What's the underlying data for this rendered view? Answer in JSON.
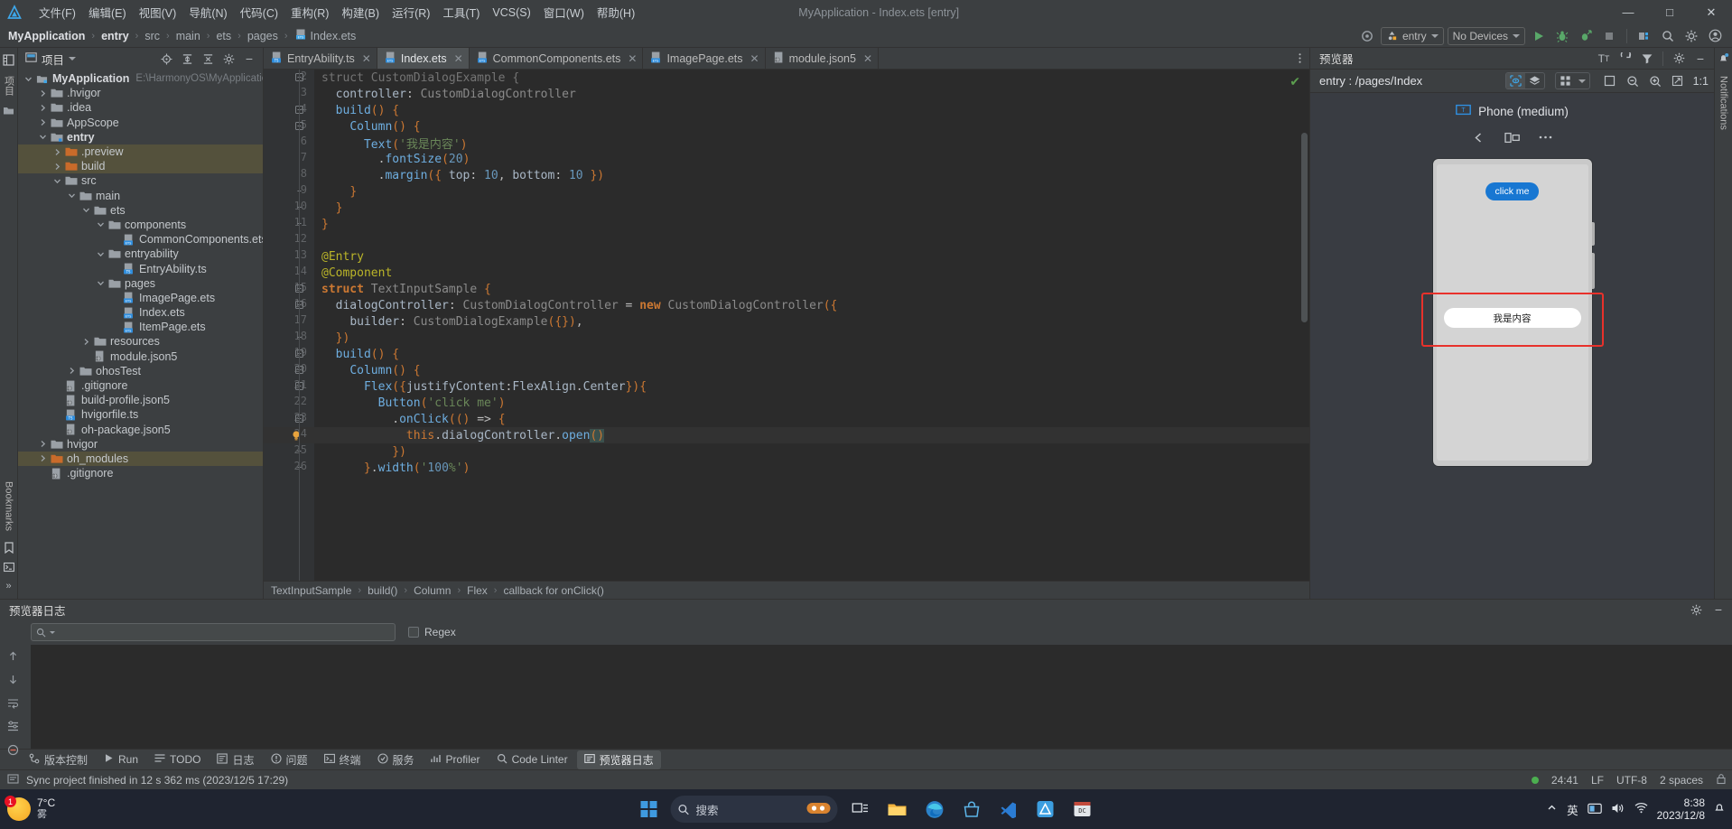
{
  "window": {
    "title": "MyApplication - Index.ets [entry]",
    "minimize": "—",
    "maximize": "□",
    "close": "✕"
  },
  "menu": [
    {
      "label": "文件(F)"
    },
    {
      "label": "编辑(E)"
    },
    {
      "label": "视图(V)"
    },
    {
      "label": "导航(N)"
    },
    {
      "label": "代码(C)"
    },
    {
      "label": "重构(R)"
    },
    {
      "label": "构建(B)"
    },
    {
      "label": "运行(R)"
    },
    {
      "label": "工具(T)"
    },
    {
      "label": "VCS(S)"
    },
    {
      "label": "窗口(W)"
    },
    {
      "label": "帮助(H)"
    }
  ],
  "breadcrumb": {
    "items": [
      "MyApplication",
      "entry",
      "src",
      "main",
      "ets",
      "pages"
    ],
    "file": "Index.ets",
    "separator": "›"
  },
  "toolbar": {
    "run_config": "entry",
    "device": "No Devices",
    "icons": [
      "target-icon",
      "run-icon",
      "debug-icon",
      "profile-run-icon",
      "stop-icon",
      "device-manager-icon",
      "search-everywhere-icon",
      "settings-icon",
      "account-icon"
    ]
  },
  "project": {
    "title": "项目",
    "root": "MyApplication",
    "root_path": "E:\\HarmonyOS\\MyApplicatio",
    "items": [
      {
        "label": ".hvigor",
        "indent": 1,
        "type": "folder",
        "arrow": "right",
        "hl": false
      },
      {
        "label": ".idea",
        "indent": 1,
        "type": "folder",
        "arrow": "right",
        "hl": false
      },
      {
        "label": "AppScope",
        "indent": 1,
        "type": "folder",
        "arrow": "right",
        "hl": false
      },
      {
        "label": "entry",
        "indent": 1,
        "type": "module",
        "arrow": "down",
        "hl": false,
        "bold": true
      },
      {
        "label": ".preview",
        "indent": 2,
        "type": "folder-orange",
        "arrow": "right",
        "hl": true
      },
      {
        "label": "build",
        "indent": 2,
        "type": "folder-orange",
        "arrow": "right",
        "hl": true
      },
      {
        "label": "src",
        "indent": 2,
        "type": "folder",
        "arrow": "down",
        "hl": false
      },
      {
        "label": "main",
        "indent": 3,
        "type": "folder",
        "arrow": "down",
        "hl": false
      },
      {
        "label": "ets",
        "indent": 4,
        "type": "folder",
        "arrow": "down",
        "hl": false
      },
      {
        "label": "components",
        "indent": 5,
        "type": "folder",
        "arrow": "down",
        "hl": false
      },
      {
        "label": "CommonComponents.ets",
        "indent": 6,
        "type": "ets",
        "arrow": "none",
        "hl": false
      },
      {
        "label": "entryability",
        "indent": 5,
        "type": "folder",
        "arrow": "down",
        "hl": false
      },
      {
        "label": "EntryAbility.ts",
        "indent": 6,
        "type": "ts",
        "arrow": "none",
        "hl": false
      },
      {
        "label": "pages",
        "indent": 5,
        "type": "folder",
        "arrow": "down",
        "hl": false
      },
      {
        "label": "ImagePage.ets",
        "indent": 6,
        "type": "ets",
        "arrow": "none",
        "hl": false
      },
      {
        "label": "Index.ets",
        "indent": 6,
        "type": "ets",
        "arrow": "none",
        "hl": false
      },
      {
        "label": "ItemPage.ets",
        "indent": 6,
        "type": "ets",
        "arrow": "none",
        "hl": false
      },
      {
        "label": "resources",
        "indent": 4,
        "type": "folder",
        "arrow": "right",
        "hl": false
      },
      {
        "label": "module.json5",
        "indent": 4,
        "type": "json",
        "arrow": "none",
        "hl": false
      },
      {
        "label": "ohosTest",
        "indent": 3,
        "type": "folder",
        "arrow": "right",
        "hl": false
      },
      {
        "label": ".gitignore",
        "indent": 2,
        "type": "json",
        "arrow": "none",
        "hl": false
      },
      {
        "label": "build-profile.json5",
        "indent": 2,
        "type": "json",
        "arrow": "none",
        "hl": false
      },
      {
        "label": "hvigorfile.ts",
        "indent": 2,
        "type": "ts",
        "arrow": "none",
        "hl": false
      },
      {
        "label": "oh-package.json5",
        "indent": 2,
        "type": "json",
        "arrow": "none",
        "hl": false
      },
      {
        "label": "hvigor",
        "indent": 1,
        "type": "folder",
        "arrow": "right",
        "hl": false
      },
      {
        "label": "oh_modules",
        "indent": 1,
        "type": "folder-orange",
        "arrow": "right",
        "hl": true
      },
      {
        "label": ".gitignore",
        "indent": 1,
        "type": "json",
        "arrow": "none",
        "hl": false
      }
    ]
  },
  "editor": {
    "tabs": [
      {
        "label": "EntryAbility.ts",
        "type": "ts",
        "active": false
      },
      {
        "label": "Index.ets",
        "type": "ets",
        "active": true
      },
      {
        "label": "CommonComponents.ets",
        "type": "ets",
        "active": false
      },
      {
        "label": "ImagePage.ets",
        "type": "ets",
        "active": false
      },
      {
        "label": "module.json5",
        "type": "json",
        "active": false
      }
    ],
    "first_line_number": 2,
    "lines": [
      {
        "n": 2,
        "fold": "open",
        "partial": true
      },
      {
        "n": 3,
        "fold": "none"
      },
      {
        "n": 4,
        "fold": "open"
      },
      {
        "n": 5,
        "fold": "open"
      },
      {
        "n": 6,
        "fold": "none"
      },
      {
        "n": 7,
        "fold": "none"
      },
      {
        "n": 8,
        "fold": "none"
      },
      {
        "n": 9,
        "fold": "close"
      },
      {
        "n": 10,
        "fold": "close"
      },
      {
        "n": 11,
        "fold": "close"
      },
      {
        "n": 12,
        "fold": "none"
      },
      {
        "n": 13,
        "fold": "none"
      },
      {
        "n": 14,
        "fold": "none"
      },
      {
        "n": 15,
        "fold": "open"
      },
      {
        "n": 16,
        "fold": "open"
      },
      {
        "n": 17,
        "fold": "none"
      },
      {
        "n": 18,
        "fold": "close"
      },
      {
        "n": 19,
        "fold": "open"
      },
      {
        "n": 20,
        "fold": "open"
      },
      {
        "n": 21,
        "fold": "open"
      },
      {
        "n": 22,
        "fold": "none"
      },
      {
        "n": 23,
        "fold": "open"
      },
      {
        "n": 24,
        "fold": "none",
        "bulb": true,
        "current": true
      },
      {
        "n": 25,
        "fold": "close"
      },
      {
        "n": 26,
        "fold": "close",
        "partial": true
      }
    ],
    "source_text": [
      "struct CustomDialogExample {",
      "  controller: CustomDialogController",
      "  build() {",
      "    Column() {",
      "      Text('我是内容')",
      "        .fontSize(20)",
      "        .margin({ top: 10, bottom: 10 })",
      "    }",
      "  }",
      "}",
      "",
      "@Entry",
      "@Component",
      "struct TextInputSample {",
      "  dialogController: CustomDialogController = new CustomDialogController({",
      "    builder: CustomDialogExample({}),",
      "  })",
      "  build() {",
      "    Column() {",
      "      Flex({justifyContent:FlexAlign.Center}){",
      "        Button('click me')",
      "          .onClick(() => {",
      "            this.dialogController.open()",
      "          })",
      "      }.width('100%')"
    ],
    "status_ok": "✔",
    "crumbs": [
      "TextInputSample",
      "build()",
      "Column",
      "Flex",
      "callback for onClick()"
    ],
    "crumb_sep": "›"
  },
  "previewer": {
    "title": "预览器",
    "route": "entry : /pages/Index",
    "zoom_label": "1:1",
    "device_name": "Phone (medium)",
    "device_buttons": [
      "rotate-left-icon",
      "device-flip-icon",
      "more-icon"
    ],
    "phone": {
      "button_label": "click me",
      "dialog_text": "我是内容"
    },
    "tools": [
      "inspector-icon",
      "layers-icon",
      "multi-device-icon",
      "chevron-down-icon",
      "frame-icon",
      "zoom-out-icon",
      "zoom-in-icon",
      "fit-icon"
    ],
    "head_tools": [
      "font-size-icon",
      "refresh-icon",
      "filter-icon",
      "settings-icon",
      "minimize-icon"
    ]
  },
  "log": {
    "title": "预览器日志",
    "search_placeholder": "",
    "search_value": "",
    "regex_label": "Regex"
  },
  "toolwindows": [
    {
      "label": "版本控制",
      "icon": "vcs-icon",
      "active": false
    },
    {
      "label": "Run",
      "icon": "run-icon",
      "active": false
    },
    {
      "label": "TODO",
      "icon": "todo-icon",
      "active": false
    },
    {
      "label": "日志",
      "icon": "log-icon",
      "active": false
    },
    {
      "label": "问题",
      "icon": "problems-icon",
      "active": false
    },
    {
      "label": "终端",
      "icon": "terminal-icon",
      "active": false
    },
    {
      "label": "服务",
      "icon": "services-icon",
      "active": false
    },
    {
      "label": "Profiler",
      "icon": "profiler-icon",
      "active": false
    },
    {
      "label": "Code Linter",
      "icon": "linter-icon",
      "active": false
    },
    {
      "label": "预览器日志",
      "icon": "preview-log-icon",
      "active": true
    }
  ],
  "statusbar": {
    "message": "Sync project finished in 12 s 362 ms (2023/12/5 17:29)",
    "caret": "24:41",
    "line_sep": "LF",
    "encoding": "UTF-8",
    "indent": "2 spaces"
  },
  "left_rails": {
    "top": "项目",
    "bookmarks": "Bookmarks"
  },
  "right_rails": {
    "notifications": "Notifications"
  },
  "taskbar": {
    "weather_temp": "7°C",
    "weather_desc": "雾",
    "weather_badge": "1",
    "search_placeholder": "搜索",
    "time": "8:38",
    "date": "2023/12/8",
    "ime": "英",
    "apps": [
      "task-view-icon",
      "file-explorer-icon",
      "edge-icon",
      "store-icon",
      "vscode-icon",
      "deveco-icon",
      "devtool-icon"
    ]
  },
  "colors": {
    "accent_blue": "#1877d2",
    "red_outline": "#e8312b",
    "green_run": "#59a869",
    "panel_bg": "#3c3f41",
    "editor_bg": "#2b2b2b"
  }
}
